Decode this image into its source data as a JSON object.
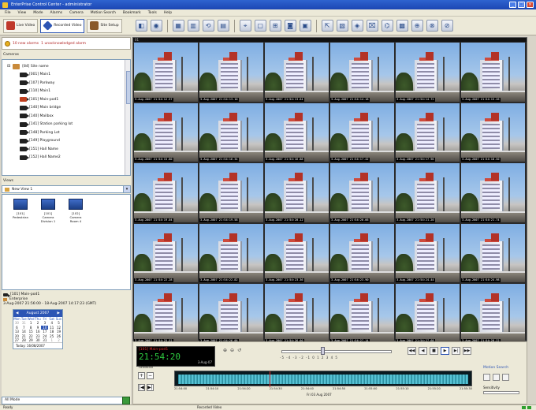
{
  "window": {
    "title": "EnterPrise Control Center - administrator"
  },
  "menu": [
    "File",
    "View",
    "Mode",
    "Alarms",
    "Camera",
    "Motion Search",
    "Bookmark",
    "Tools",
    "Help"
  ],
  "modes": [
    {
      "label": "Live Video",
      "color": "#c0392b"
    },
    {
      "label": "Recorded Video",
      "color": "#2d55b4"
    },
    {
      "label": "Site Setup",
      "color": "#8a5a2b"
    }
  ],
  "toolbar_icons": [
    "◧",
    "◉",
    "▦",
    "▥",
    "⟲",
    "▤",
    "⌖",
    "▢",
    "⊞",
    "◙",
    "▣",
    "⇱",
    "▧",
    "◈",
    "⌧",
    "⌬",
    "▩",
    "⊕",
    "⊗",
    "⊘"
  ],
  "alarms": {
    "new_alarms": "10 new alarms",
    "unacked": "1 unacknowledged alarm"
  },
  "cameras_pane": {
    "title": "Cameras",
    "site": "[84] Site name",
    "items": [
      "[001] Main1",
      "[107] Parkway",
      "[110] Main1",
      "[101] Main-pod1",
      "[140] Main bridge",
      "[140] Mailbox",
      "[141] Station parking lot",
      "[148] Parking Lot",
      "[149] Playground",
      "[151] Hall Name",
      "[152] Hall Name2"
    ]
  },
  "views_pane": {
    "title": "Views",
    "selected": "New View 1",
    "items": [
      "[101] Pedestrian",
      "[101] Camera Division 1",
      "[102] Camera Room 4"
    ]
  },
  "clip_info": {
    "camera": "[101] Main-pod1",
    "site": "Enterprise",
    "range": "3-Aug-2007 21:56:00 - 18-Aug-2007 14:17:23 (GMT)"
  },
  "calendar": {
    "month": "August 2007",
    "days_header": [
      "Mon",
      "Tue",
      "Wed",
      "Thu",
      "Fri",
      "Sat",
      "Sun"
    ],
    "cells": [
      "30",
      "31",
      "1",
      "2",
      "3",
      "4",
      "5",
      "6",
      "7",
      "8",
      "9",
      "10",
      "11",
      "12",
      "13",
      "14",
      "15",
      "16",
      "17",
      "18",
      "19",
      "20",
      "21",
      "22",
      "23",
      "24",
      "25",
      "26",
      "27",
      "28",
      "29",
      "30",
      "31",
      "1",
      "2"
    ],
    "selected": "10",
    "today": "Today: 16/08/2007"
  },
  "mode_select": "All Mode",
  "main_header": "01",
  "grid": {
    "rows": 5,
    "cols": 6,
    "timestamps": [
      "3-Aug-2007 21:54:12.57",
      "3-Aug-2007 21:54:13.10",
      "3-Aug-2007 21:54:13.64",
      "3-Aug-2007 21:54:14.18",
      "3-Aug-2007 21:54:14.72",
      "3-Aug-2007 21:54:15.26",
      "3-Aug-2007 21:54:15.80",
      "3-Aug-2007 21:54:16.34",
      "3-Aug-2007 21:54:16.88",
      "3-Aug-2007 21:54:17.42",
      "3-Aug-2007 21:54:17.96",
      "3-Aug-2007 21:54:18.50",
      "3-Aug-2007 21:54:19.04",
      "3-Aug-2007 21:54:19.58",
      "3-Aug-2007 21:54:20.12",
      "3-Aug-2007 21:54:20.66",
      "3-Aug-2007 21:54:21.20",
      "3-Aug-2007 21:54:21.74",
      "3-Aug-2007 21:54:22.28",
      "3-Aug-2007 21:54:22.82",
      "3-Aug-2007 21:54:23.36",
      "3-Aug-2007 21:54:23.90",
      "3-Aug-2007 21:54:24.44",
      "3-Aug-2007 21:54:24.98",
      "3-Aug-2007 21:54:25.52",
      "3-Aug-2007 21:54:26.06",
      "3-Aug-2007 21:54:26.60",
      "3-Aug-2007 21:54:27.14",
      "3-Aug-2007 21:54:27.68",
      "3-Aug-2007 21:54:28.22"
    ]
  },
  "playback": {
    "camera": "[101] Main-pod1",
    "time": "21:54:20",
    "date": "3-Aug-07",
    "speed_ticks": "-5 -4 -3 -2 -1 0 1 2 3 4 5",
    "controls": [
      "◀◀",
      "◀",
      "■",
      "▶",
      "▶|",
      "▶▶"
    ],
    "timeline_label": "Timeline",
    "axis": [
      "21:54:00",
      "21:54:10",
      "21:54:20",
      "21:54:30",
      "21:54:40",
      "21:54:50",
      "21:55:00",
      "21:55:10",
      "21:55:20",
      "21:55:30"
    ],
    "timeline_date": "Fri 03 Aug 2007",
    "motion_title": "Motion Search",
    "motion_label": "Sensitivity"
  },
  "status": {
    "left": "Ready",
    "mid": "Recorded Video"
  }
}
